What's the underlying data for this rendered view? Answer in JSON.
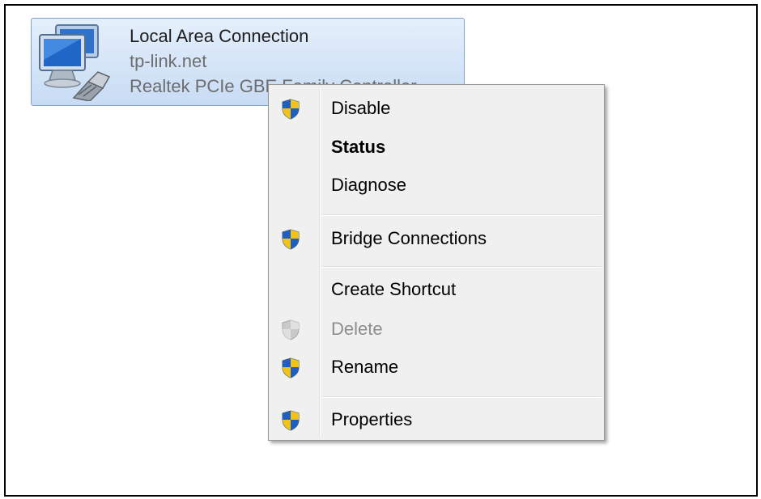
{
  "adapter": {
    "name": "Local Area Connection",
    "network": "tp-link.net",
    "device": "Realtek PCIe GBE Family Controller",
    "icon": "network-adapter-icon"
  },
  "context_menu": {
    "items": [
      {
        "label": "Disable",
        "icon": "uac-shield-icon",
        "bold": false,
        "disabled": false
      },
      {
        "label": "Status",
        "icon": null,
        "bold": true,
        "disabled": false
      },
      {
        "label": "Diagnose",
        "icon": null,
        "bold": false,
        "disabled": false
      },
      {
        "label": "Bridge Connections",
        "icon": "uac-shield-icon",
        "bold": false,
        "disabled": false
      },
      {
        "label": "Create Shortcut",
        "icon": null,
        "bold": false,
        "disabled": false
      },
      {
        "label": "Delete",
        "icon": "uac-shield-icon",
        "bold": false,
        "disabled": true
      },
      {
        "label": "Rename",
        "icon": "uac-shield-icon",
        "bold": false,
        "disabled": false
      },
      {
        "label": "Properties",
        "icon": "uac-shield-icon",
        "bold": false,
        "disabled": false
      }
    ]
  },
  "colors": {
    "tile_border": "#7da2ce",
    "menu_background": "#f0f0f0",
    "disabled_text": "#8d8d8d"
  }
}
